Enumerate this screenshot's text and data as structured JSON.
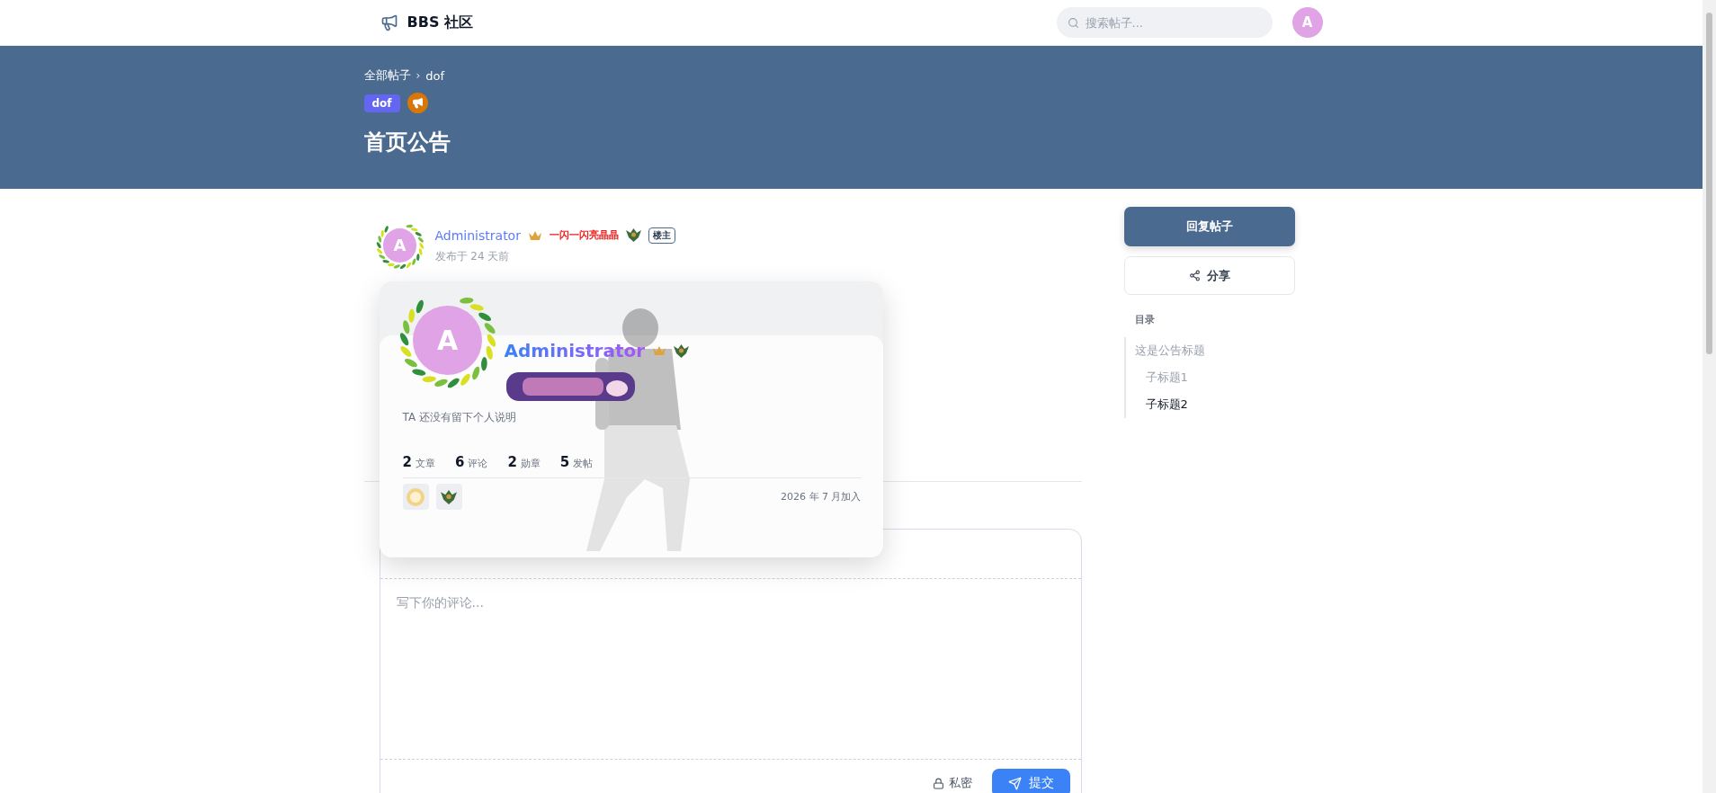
{
  "header": {
    "logo_text": "BBS 社区",
    "search": {
      "placeholder": "搜索帖子..."
    },
    "avatar": "A"
  },
  "banner": {
    "breadcrumb": [
      "全部帖子",
      "dof"
    ],
    "breadcrumb_separator": "›",
    "tags": [
      {
        "kind": "label",
        "text": "dof",
        "color": "#6366f1"
      },
      {
        "kind": "icon",
        "color": "#d97706"
      }
    ],
    "title": "首页公告"
  },
  "post": {
    "author": {
      "name": "Administrator",
      "avatar": "A",
      "title_badge": "一闪一闪亮晶晶",
      "role_badge": "楼主"
    },
    "published": "发布于 24 天前"
  },
  "profile_card": {
    "name": "Administrator",
    "avatar": "A",
    "bio": "TA 还没有留下个人说明",
    "stats": [
      {
        "value": "2",
        "label": "文章"
      },
      {
        "value": "6",
        "label": "评论"
      },
      {
        "value": "2",
        "label": "勋章"
      },
      {
        "value": "5",
        "label": "发帖"
      }
    ],
    "joined": "2026 年 7 月加入"
  },
  "sidebar": {
    "reply_button": "回复帖子",
    "share_button": "分享",
    "toc": {
      "heading": "目录",
      "items": [
        {
          "text": "这是公告标题",
          "selected": false,
          "children": [
            {
              "text": "子标题1",
              "selected": false
            },
            {
              "text": "子标题2",
              "selected": true
            }
          ]
        }
      ]
    }
  },
  "comment": {
    "placeholder": "写下你的评论...",
    "private_label": "私密",
    "submit": "提交"
  }
}
